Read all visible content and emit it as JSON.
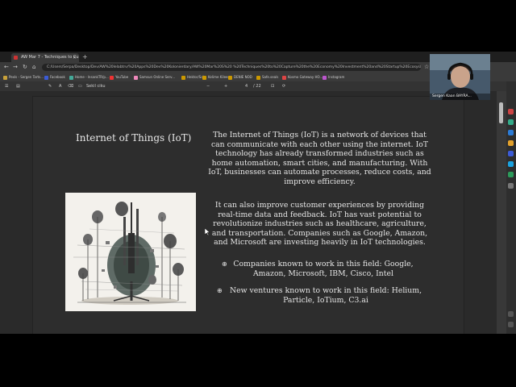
{
  "browser": {
    "tab_title": "AW Mar 7 - Techniques to Cu",
    "url": "C:/Users/Serpa/Desktop/Dev/AW%20lelabtrv/%20Apps%20Dev%20Kolonierdary/AW%20Mar%20S%20 %20Techniques%20to%20Capture%20the%20Economy%20Investment%20and%20Startup%20Ecosyste...",
    "bookmarks": [
      "Pexls - Sergen Tarts...",
      "Facebook",
      "Home - lnsankTR/p...",
      "YouTube",
      "Samsun Online Serv...",
      "Hektor/Sci",
      "Kelime Kileen",
      "DENIE NOD",
      "Safe.seals",
      "Kosmo Gateway HO...",
      "Instagram"
    ],
    "pdf_label": "Sekil ciku",
    "page_indicator": "/ 22"
  },
  "slide": {
    "title": "Internet of Things (IoT)",
    "paragraph1": "The Internet of Things (IoT) is a network of devices that can communicate with each other using the internet. IoT technology has already transformed industries such as home automation, smart cities, and manufacturing. With IoT, businesses can automate processes, reduce costs, and improve efficiency.",
    "paragraph2": "It can also improve customer experiences by providing real-time data and feedback. IoT has vast potential to revolutionize industries such as healthcare, agriculture, and transportation. Companies such as Google, Amazon, and Microsoft are investing heavily in IoT technologies.",
    "bullet1": "Companies known to work in this field: Google, Amazon, Microsoft, IBM, Cisco, Intel",
    "bullet2": "New ventures known to work in this field: Helium, Particle, IoTium, C3.ai"
  },
  "webcam": {
    "name": "Sergen Kaan BAYRA..."
  },
  "colors": {
    "slide_bg": "#2d2d2d",
    "text": "#e6e6e6",
    "browser_chrome": "#3a3a3a"
  }
}
